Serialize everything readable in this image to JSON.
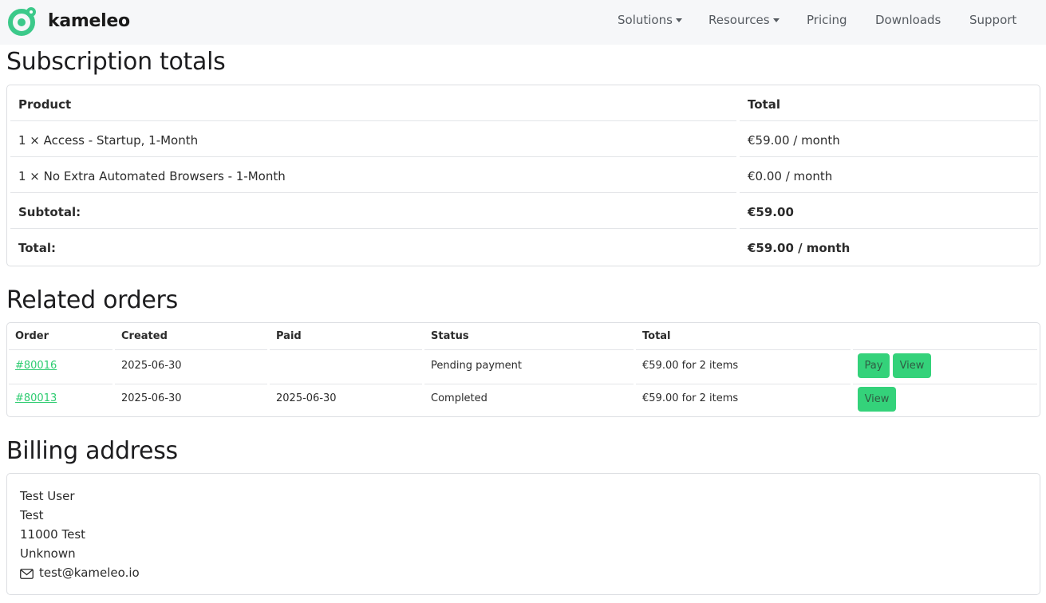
{
  "brand": {
    "name": "kameleo",
    "accent": "#34d27a"
  },
  "nav": {
    "items": [
      {
        "label": "Solutions",
        "dropdown": true
      },
      {
        "label": "Resources",
        "dropdown": true
      },
      {
        "label": "Pricing",
        "dropdown": false
      },
      {
        "label": "Downloads",
        "dropdown": false
      },
      {
        "label": "Support",
        "dropdown": false
      }
    ]
  },
  "subscription_totals": {
    "heading": "Subscription totals",
    "columns": [
      "Product",
      "Total"
    ],
    "rows": [
      {
        "product": "1 × Access - Startup, 1-Month",
        "total": "€59.00 / month"
      },
      {
        "product": "1 × No Extra Automated Browsers - 1-Month",
        "total": "€0.00 / month"
      }
    ],
    "subtotal": {
      "label": "Subtotal:",
      "value": "€59.00"
    },
    "total": {
      "label": "Total:",
      "value": "€59.00 / month"
    }
  },
  "related_orders": {
    "heading": "Related orders",
    "columns": [
      "Order",
      "Created",
      "Paid",
      "Status",
      "Total"
    ],
    "rows": [
      {
        "order": "#80016",
        "created": "2025-06-30",
        "paid": "",
        "status": "Pending payment",
        "total": "€59.00 for 2 items",
        "actions": [
          "Pay",
          "View"
        ]
      },
      {
        "order": "#80013",
        "created": "2025-06-30",
        "paid": "2025-06-30",
        "status": "Completed",
        "total": "€59.00 for 2 items",
        "actions": [
          "View"
        ]
      }
    ]
  },
  "billing_address": {
    "heading": "Billing address",
    "lines": [
      "Test User",
      "Test",
      "11000 Test",
      "Unknown"
    ],
    "email": "test@kameleo.io",
    "email_icon": "envelope-icon"
  }
}
